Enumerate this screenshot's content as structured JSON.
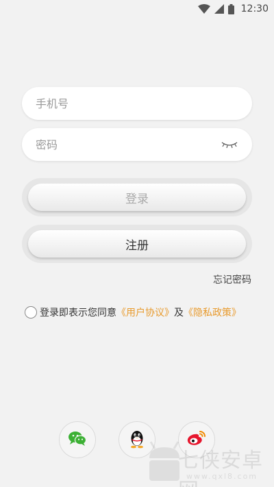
{
  "status_bar": {
    "time": "12:30",
    "icons": [
      "wifi-icon",
      "cell-signal-icon",
      "battery-icon"
    ]
  },
  "login_form": {
    "phone_placeholder": "手机号",
    "phone_value": "",
    "password_placeholder": "密码",
    "password_value": "",
    "password_toggle_icon": "eye-closed-icon",
    "login_label": "登录",
    "register_label": "注册",
    "forgot_label": "忘记密码"
  },
  "agreement": {
    "checked": false,
    "prefix": "登录即表示您同意",
    "user_agreement": "《用户协议》",
    "conjunction": "及",
    "privacy_policy": "《隐私政策》"
  },
  "social_login": {
    "items": [
      "wechat-icon",
      "qq-icon",
      "weibo-icon"
    ]
  },
  "watermark": {
    "text": "七侠安卓网",
    "url": "www.qxl8.com"
  },
  "colors": {
    "background": "#f2f2f2",
    "link": "#e89a2c",
    "wechat_green": "#3cb034",
    "weibo_red": "#e6162d"
  }
}
